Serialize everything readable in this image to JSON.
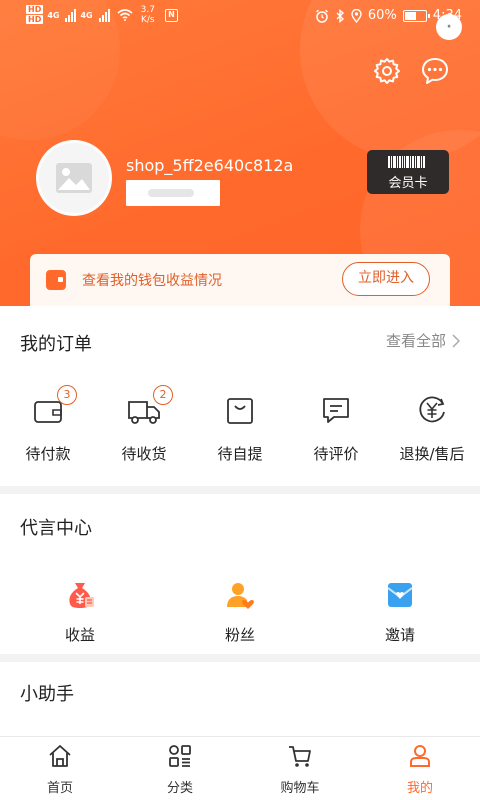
{
  "status_bar": {
    "hd_labels": [
      "HD",
      "HD"
    ],
    "net_labels": [
      "4G",
      "4G"
    ],
    "speed_value": "3.7",
    "speed_unit": "K/s",
    "nfc_label": "N",
    "battery_text": "60%",
    "battery_level": 0.6,
    "time": "4:34",
    "floating_button": "·"
  },
  "header": {
    "username": "shop_5ff2e640c812a",
    "member_card_label": "会员卡",
    "wallet_text": "查看我的钱包收益情况",
    "wallet_button": "立即进入"
  },
  "orders": {
    "title": "我的订单",
    "view_all": "查看全部",
    "items": [
      {
        "label": "待付款",
        "badge": "3",
        "icon": "wallet-icon"
      },
      {
        "label": "待收货",
        "badge": "2",
        "icon": "truck-icon"
      },
      {
        "label": "待自提",
        "badge": "",
        "icon": "bag-icon"
      },
      {
        "label": "待评价",
        "badge": "",
        "icon": "comment-icon"
      },
      {
        "label": "退换/售后",
        "badge": "",
        "icon": "refund-icon"
      }
    ]
  },
  "spokesperson": {
    "title": "代言中心",
    "items": [
      {
        "label": "收益",
        "icon": "money-bag-icon"
      },
      {
        "label": "粉丝",
        "icon": "fans-icon"
      },
      {
        "label": "邀请",
        "icon": "invite-icon"
      }
    ]
  },
  "assistant": {
    "title": "小助手"
  },
  "tabbar": {
    "items": [
      {
        "label": "首页",
        "icon": "home-icon"
      },
      {
        "label": "分类",
        "icon": "category-icon"
      },
      {
        "label": "购物车",
        "icon": "cart-icon"
      },
      {
        "label": "我的",
        "icon": "profile-icon"
      }
    ],
    "active_index": 3
  },
  "colors": {
    "accent": "#ff6a2c",
    "accent_text": "#e0602a",
    "card_dark": "#2f2b2b"
  }
}
